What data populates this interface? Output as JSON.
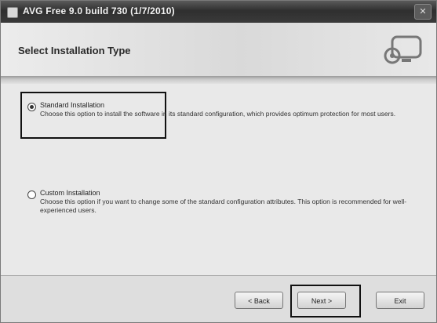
{
  "window": {
    "title": "AVG Free 9.0 build 730 (1/7/2010)"
  },
  "header": {
    "title": "Select Installation Type",
    "graphic_icon": "monitor-icon"
  },
  "options": [
    {
      "label": "Standard Installation",
      "description": "Choose this option to install the software in its standard configuration, which provides optimum protection for most users.",
      "selected": true
    },
    {
      "label": "Custom Installation",
      "description": "Choose this option if you want to change some of the standard configuration attributes. This option is recommended for well-experienced users.",
      "selected": false
    }
  ],
  "buttons": {
    "back": "< Back",
    "next": "Next >",
    "exit": "Exit"
  }
}
